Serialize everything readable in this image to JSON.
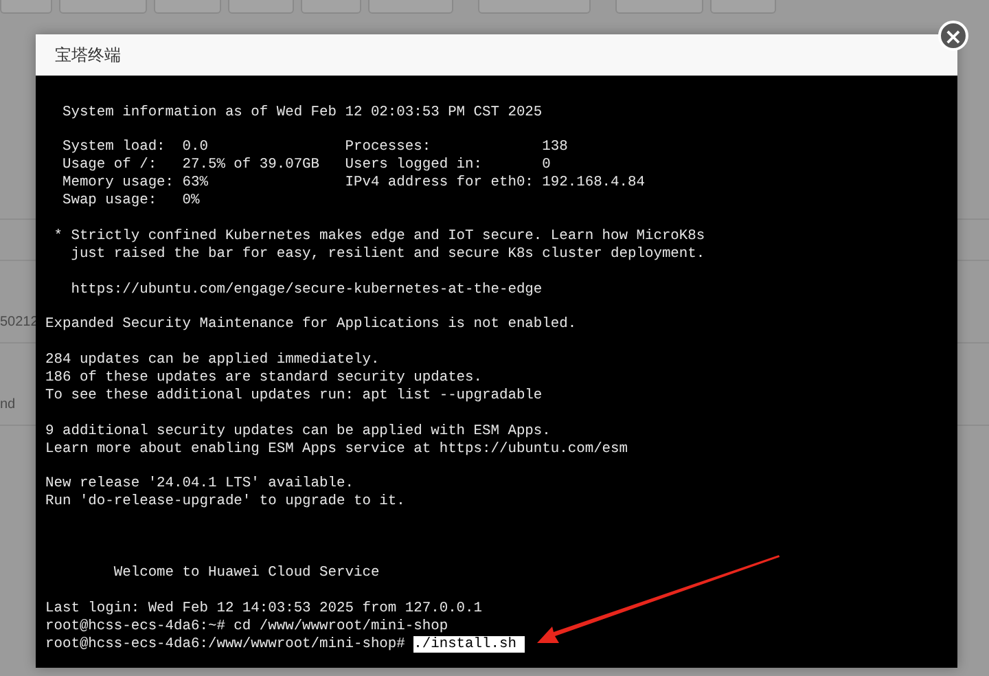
{
  "background_page": {
    "cells": [
      "50212",
      "nd"
    ]
  },
  "dialog": {
    "title": "宝塔终端",
    "close_label": "×",
    "terminal": {
      "blocks": [
        {
          "kind": "text",
          "lines": [
            "  System information as of Wed Feb 12 02:03:53 PM CST 2025"
          ]
        },
        {
          "kind": "text",
          "lines": [
            "  System load:  0.0                Processes:             138",
            "  Usage of /:   27.5% of 39.07GB   Users logged in:       0",
            "  Memory usage: 63%                IPv4 address for eth0: 192.168.4.84",
            "  Swap usage:   0%"
          ]
        },
        {
          "kind": "text",
          "lines": [
            " * Strictly confined Kubernetes makes edge and IoT secure. Learn how MicroK8s",
            "   just raised the bar for easy, resilient and secure K8s cluster deployment."
          ]
        },
        {
          "kind": "text",
          "lines": [
            "   https://ubuntu.com/engage/secure-kubernetes-at-the-edge"
          ]
        },
        {
          "kind": "text",
          "lines": [
            "Expanded Security Maintenance for Applications is not enabled."
          ]
        },
        {
          "kind": "text",
          "lines": [
            "284 updates can be applied immediately.",
            "186 of these updates are standard security updates.",
            "To see these additional updates run: apt list --upgradable"
          ]
        },
        {
          "kind": "text",
          "lines": [
            "9 additional security updates can be applied with ESM Apps.",
            "Learn more about enabling ESM Apps service at https://ubuntu.com/esm"
          ]
        },
        {
          "kind": "text",
          "lines": [
            "New release '24.04.1 LTS' available.",
            "Run 'do-release-upgrade' to upgrade to it."
          ]
        },
        {
          "kind": "banner",
          "lines": [
            "        Welcome to Huawei Cloud Service"
          ]
        },
        {
          "kind": "text",
          "lines": [
            "Last login: Wed Feb 12 14:03:53 2025 from 127.0.0.1",
            "root@hcss-ecs-4da6:~# cd /www/wwwroot/mini-shop"
          ]
        }
      ],
      "prompt": {
        "text": "root@hcss-ecs-4da6:/www/wwwroot/mini-shop# ",
        "command": "./install.sh ",
        "highlighted": true
      }
    }
  }
}
